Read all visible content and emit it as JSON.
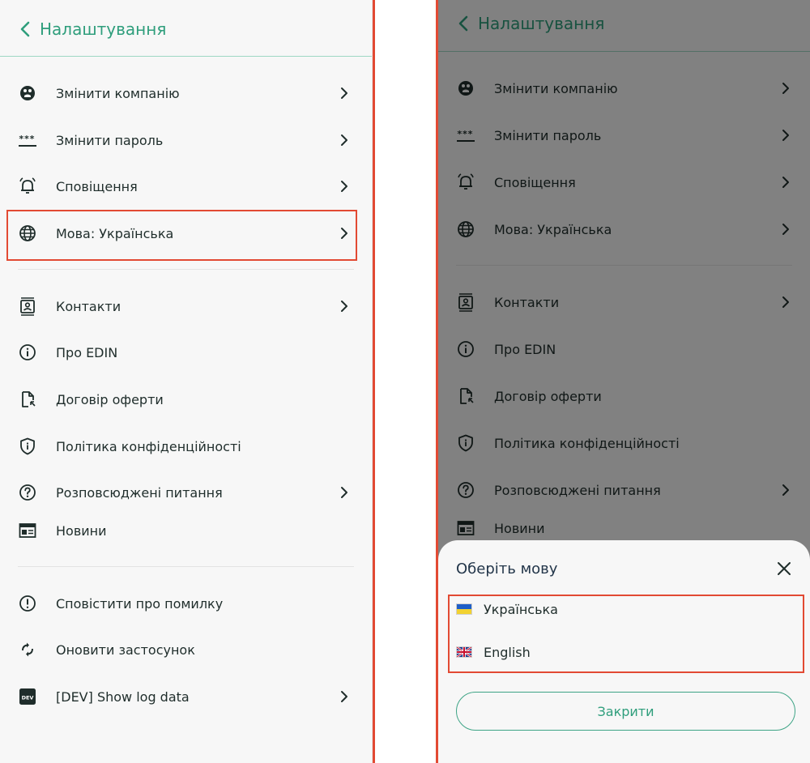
{
  "header": {
    "title": "Налаштування"
  },
  "menu": {
    "items": [
      {
        "label": "Змінити компанію",
        "icon": "company-icon"
      },
      {
        "label": "Змінити пароль",
        "icon": "password-icon"
      },
      {
        "label": "Сповіщення",
        "icon": "bell-icon"
      },
      {
        "label": "Мова: Українська",
        "icon": "globe-icon"
      },
      {
        "label": "Контакти",
        "icon": "contacts-icon"
      },
      {
        "label": "Про EDIN",
        "icon": "info-icon"
      },
      {
        "label": "Договір оферти",
        "icon": "document-icon"
      },
      {
        "label": "Політика конфіденційності",
        "icon": "shield-icon"
      },
      {
        "label": "Розповсюджені питання",
        "icon": "question-icon"
      },
      {
        "label": "Новини",
        "icon": "news-icon"
      },
      {
        "label": "Сповістити про помилку",
        "icon": "alert-icon"
      },
      {
        "label": "Оновити застосунок",
        "icon": "refresh-icon"
      },
      {
        "label": "[DEV] Show log data",
        "icon": "dev-icon"
      }
    ]
  },
  "dev_badge": "DEV",
  "language_sheet": {
    "title": "Оберіть мову",
    "options": [
      {
        "label": "Українська",
        "flag": "ukraine-flag-icon"
      },
      {
        "label": "English",
        "flag": "uk-flag-icon"
      }
    ],
    "close_label": "Закрити"
  },
  "colors": {
    "accent": "#2f9e7c",
    "highlight": "#e24a33",
    "divider": "#9fd7c3"
  }
}
